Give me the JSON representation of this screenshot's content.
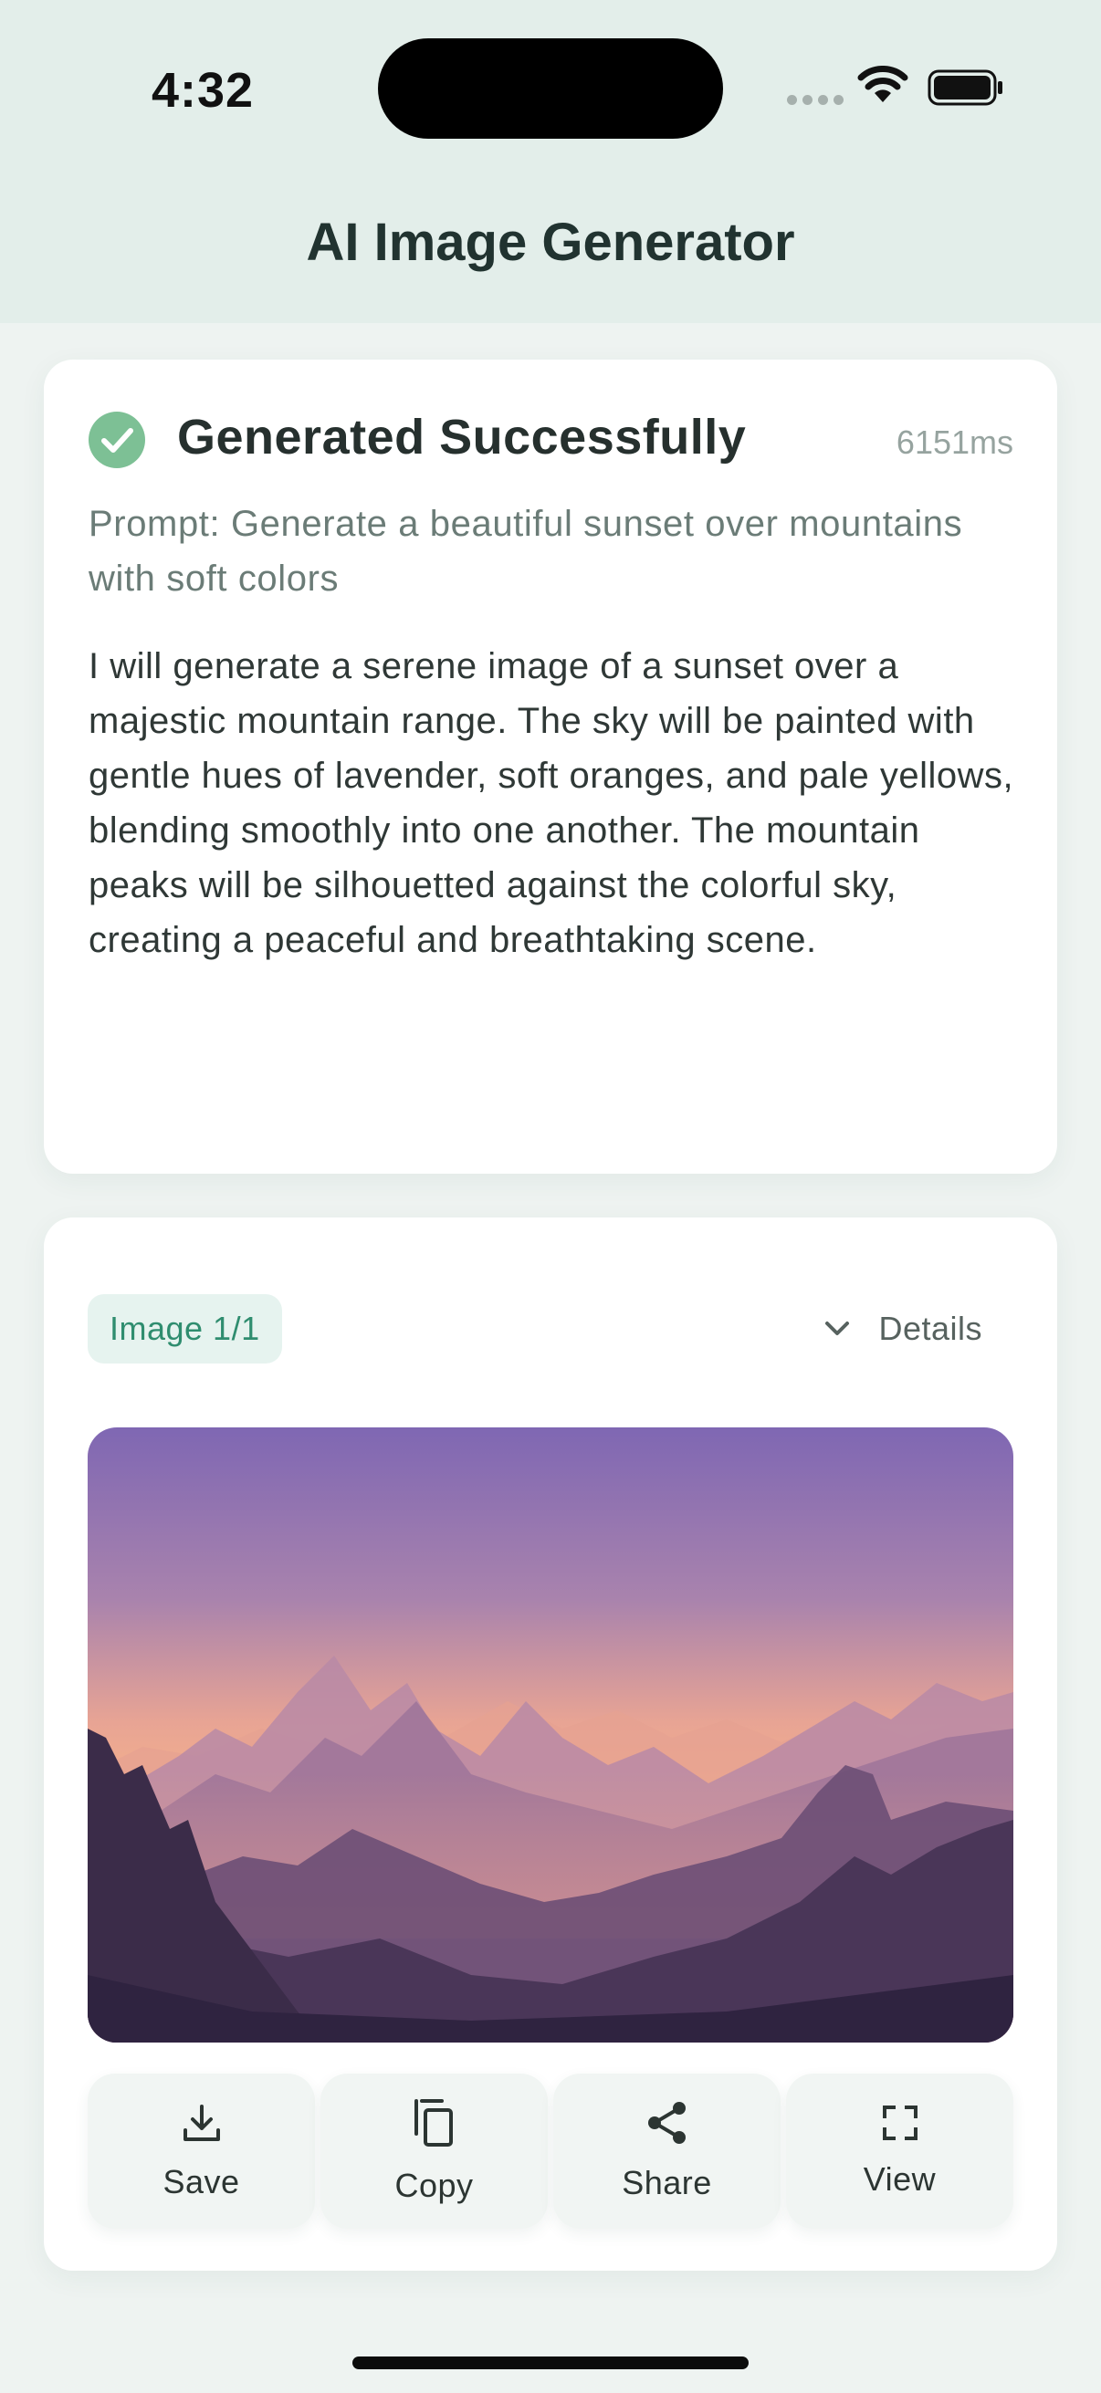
{
  "status_bar": {
    "time": "4:32"
  },
  "header": {
    "title": "AI Image Generator"
  },
  "result": {
    "status": "Generated Successfully",
    "duration": "6151ms",
    "prompt": "Prompt: Generate a beautiful sunset over mountains with soft colors",
    "description": "I will generate a serene image of a sunset over a majestic mountain range. The sky will be painted with gentle hues of lavender, soft oranges, and pale yellows, blending smoothly into one another. The mountain peaks will be silhouetted against the colorful sky, creating a peaceful and breathtaking scene."
  },
  "image_panel": {
    "badge": "Image 1/1",
    "details_label": "Details",
    "actions": [
      {
        "label": "Save",
        "icon": "download-icon"
      },
      {
        "label": "Copy",
        "icon": "copy-icon"
      },
      {
        "label": "Share",
        "icon": "share-icon"
      },
      {
        "label": "View",
        "icon": "fullscreen-icon"
      }
    ]
  },
  "colors": {
    "accent": "#2f8d6f",
    "success": "#7dc095",
    "background": "#eef3f1",
    "header_bg": "#e3eeea"
  }
}
